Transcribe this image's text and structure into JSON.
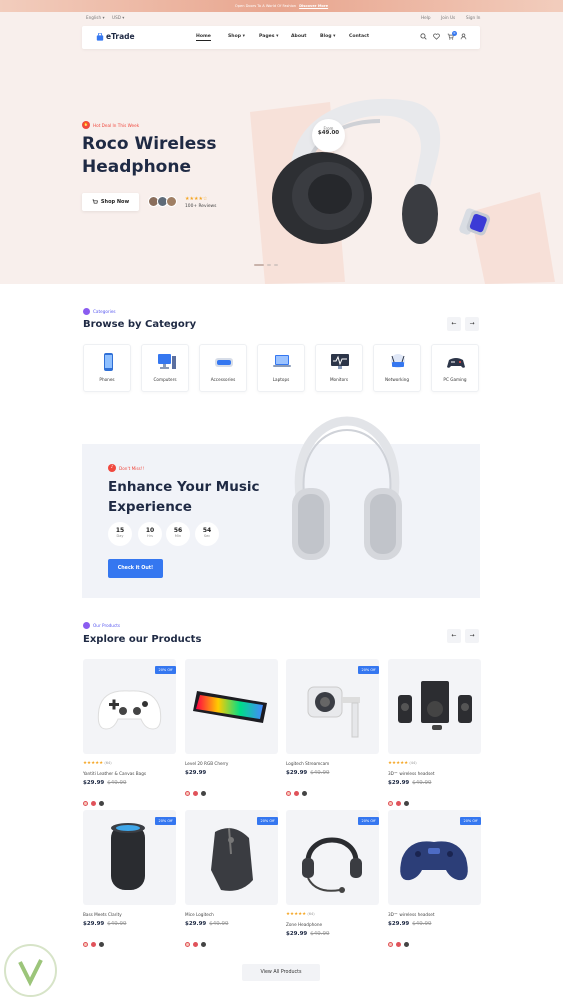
{
  "top_bar": {
    "text": "Open Doors To A World Of Fashion",
    "link": "Discover More"
  },
  "header": {
    "lang": "English",
    "currency": "USD",
    "links": [
      "Help",
      "Join Us",
      "Sign In"
    ],
    "logo": "eTrade",
    "nav": [
      "Home",
      "Shop",
      "Pages",
      "About",
      "Blog",
      "Contact"
    ],
    "cart_count": "0"
  },
  "hero": {
    "eyebrow": "Hot Deal In This Week",
    "title": "Roco Wireless Headphone",
    "cta": "Shop Now",
    "reviews": "100+ Reviews",
    "rating_stars": "★★★★☆",
    "price_label": "From",
    "price": "$49.00"
  },
  "categories": {
    "eyebrow": "Categories",
    "title": "Browse by Category",
    "items": [
      "Phones",
      "Computers",
      "Accessories",
      "Laptops",
      "Monitors",
      "Networking",
      "PC Gaming"
    ]
  },
  "promo": {
    "eyebrow": "Don't Miss!!",
    "title": "Enhance Your Music Experience",
    "countdown": [
      {
        "value": "15",
        "unit": "Day"
      },
      {
        "value": "10",
        "unit": "Hrs"
      },
      {
        "value": "56",
        "unit": "Min"
      },
      {
        "value": "54",
        "unit": "Sec"
      }
    ],
    "cta": "Check it Out!"
  },
  "products": {
    "eyebrow": "Our Products",
    "title": "Explore our Products",
    "badge": "20% Off",
    "items": [
      {
        "name": "Yantiti Leather & Canvas Bags",
        "price": "$29.99",
        "old_price": "$49.99",
        "rating": "★★★★★",
        "reviews": "(64)"
      },
      {
        "name": "Level 20 RGB Cherry",
        "price": "$29.99",
        "old_price": "",
        "rating": "",
        "reviews": ""
      },
      {
        "name": "Logitech Streamcam",
        "price": "$29.99",
        "old_price": "$49.99",
        "rating": "",
        "reviews": ""
      },
      {
        "name": "3D™ wireless headset",
        "price": "$29.99",
        "old_price": "$49.99",
        "rating": "★★★★★",
        "reviews": "(44)"
      },
      {
        "name": "Bass Meets Clarity",
        "price": "$29.99",
        "old_price": "$49.99",
        "rating": "",
        "reviews": ""
      },
      {
        "name": "Mice Logitech",
        "price": "$29.99",
        "old_price": "$49.99",
        "rating": "",
        "reviews": ""
      },
      {
        "name": "Zone Headphone",
        "price": "$29.99",
        "old_price": "$49.99",
        "rating": "★★★★★",
        "reviews": "(64)"
      },
      {
        "name": "3D™ wireless headset",
        "price": "$29.99",
        "old_price": "$49.99",
        "rating": "",
        "reviews": ""
      }
    ],
    "view_all": "View All Products"
  },
  "colors": {
    "accent": "#3577f0",
    "hero_bg": "#f8efec",
    "dark": "#1f2a44",
    "star": "#f5a623"
  }
}
